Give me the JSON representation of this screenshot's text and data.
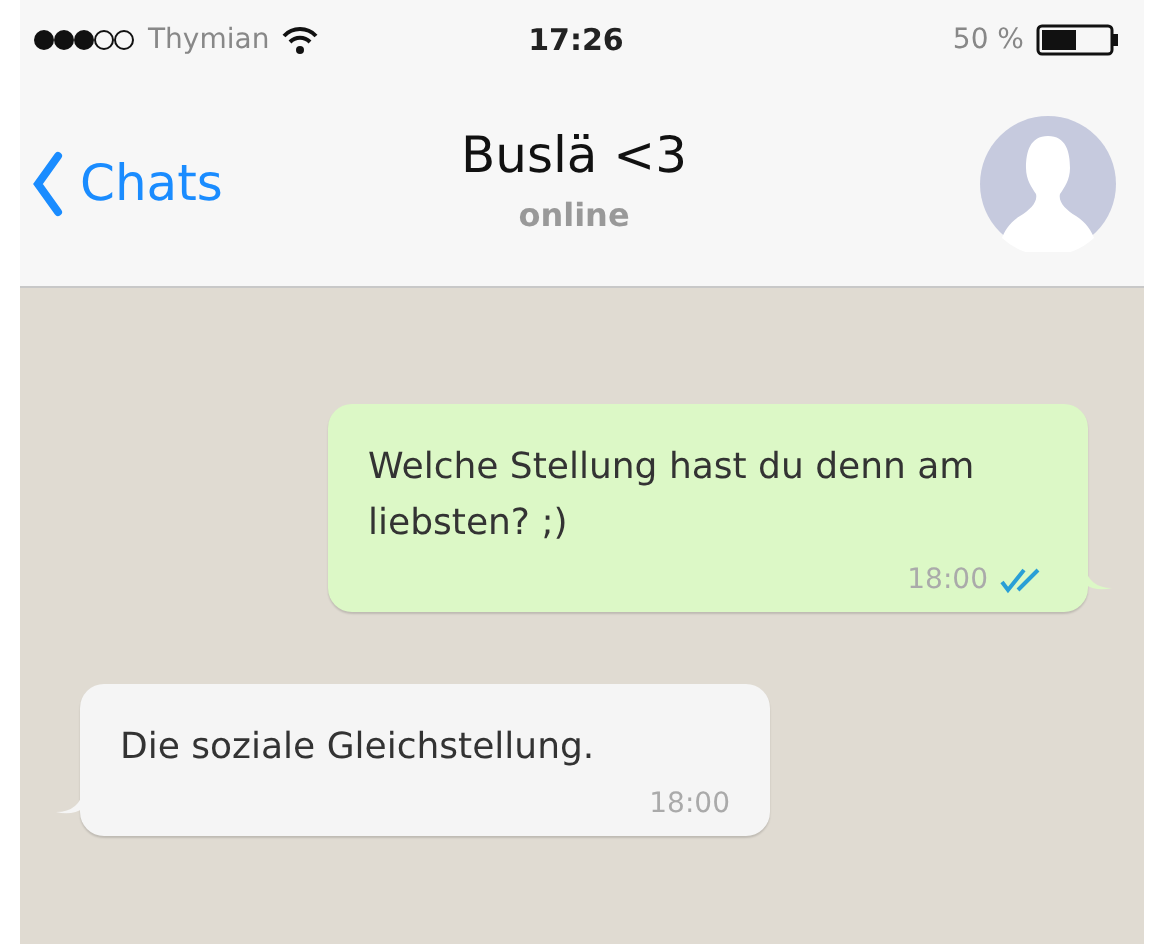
{
  "status_bar": {
    "carrier": "Thymian",
    "time": "17:26",
    "battery": "50 %"
  },
  "header": {
    "back": "Chats",
    "title": "Buslä <3",
    "subtitle": "online"
  },
  "messages": [
    {
      "kind": "outgoing",
      "text": "Welche Stellung hast du denn am liebsten? ;)",
      "time": "18:00",
      "read": true
    },
    {
      "kind": "incoming",
      "text": "Die soziale Gleichstellung.",
      "time": "18:00"
    }
  ]
}
